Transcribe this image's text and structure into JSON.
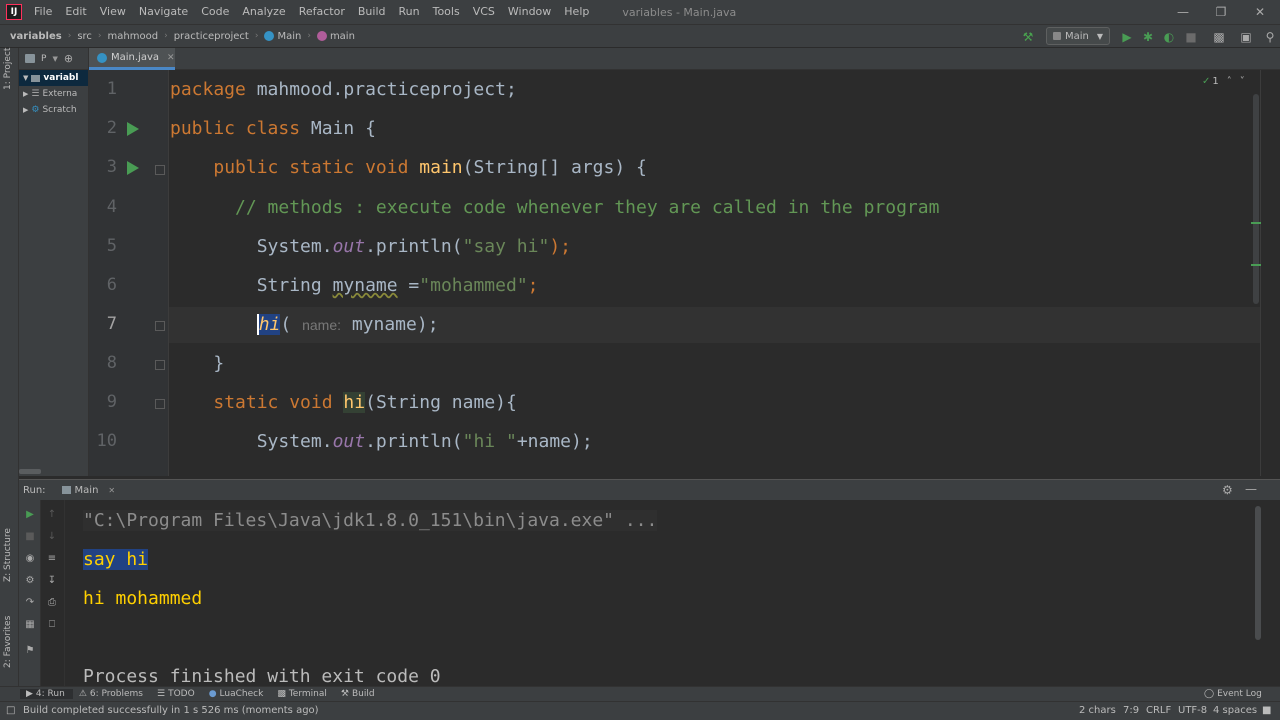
{
  "menubar": {
    "items": [
      "File",
      "Edit",
      "View",
      "Navigate",
      "Code",
      "Analyze",
      "Refactor",
      "Build",
      "Run",
      "Tools",
      "VCS",
      "Window",
      "Help"
    ],
    "window_title": "variables - Main.java"
  },
  "breadcrumbs": [
    "variables",
    "src",
    "mahmood",
    "practiceproject",
    "Main",
    "main"
  ],
  "run_config": "Main",
  "project_panel": {
    "tab": "1: Project",
    "header": "P",
    "items": [
      "variabl",
      "Externa",
      "Scratch"
    ]
  },
  "editor": {
    "tab_label": "Main.java",
    "inspection_count": "1",
    "line_numbers": [
      "1",
      "2",
      "3",
      "4",
      "5",
      "6",
      "7",
      "8",
      "9",
      "10"
    ],
    "line1": {
      "kw": "package",
      "rest": " mahmood.practiceproject;"
    },
    "line2": {
      "kw": "public class",
      "rest": " Main {"
    },
    "line3": {
      "indent": "    ",
      "kw": "public static void",
      "sp": " ",
      "fn": "main",
      "rest": "(String[] args) {"
    },
    "line4": {
      "text": "      // methods : execute code whenever they are called in the program"
    },
    "line5": {
      "a": "        System.",
      "b": "out",
      "c": ".println(",
      "d": "\"say hi\"",
      "e": ");"
    },
    "line6": {
      "a": "        String ",
      "b": "myname",
      "c": " =",
      "d": "\"mohammed\"",
      "e": ";"
    },
    "line7": {
      "indent": "        ",
      "fn": "hi",
      "paren": "( ",
      "hint": "name:",
      "rest": " myname);"
    },
    "line8": {
      "text": "    }"
    },
    "line9": {
      "indent": "    ",
      "kw": "static void",
      "sp": " ",
      "fn": "hi",
      "rest": "(String name){"
    },
    "line10": {
      "a": "        System.",
      "b": "out",
      "c": ".println(",
      "d": "\"hi \"",
      "e": "+name);"
    }
  },
  "run_panel": {
    "label": "Run:",
    "tab": "Main",
    "output": {
      "cmd": "\"C:\\Program Files\\Java\\jdk1.8.0_151\\bin\\java.exe\" ...",
      "line1": "say hi",
      "line2": "hi mohammed",
      "line3": "Process finished with exit code 0"
    }
  },
  "left_strip": {
    "structure": "Z: Structure",
    "favorites": "2: Favorites"
  },
  "bottom_tabs": [
    "4: Run",
    "6: Problems",
    "TODO",
    "LuaCheck",
    "Terminal",
    "Build"
  ],
  "event_log": "Event Log",
  "status": {
    "message": "Build completed successfully in 1 s 526 ms (moments ago)",
    "chars": "2 chars",
    "position": "7:9",
    "line_sep": "CRLF",
    "encoding": "UTF-8",
    "indent": "4 spaces"
  },
  "colors": {
    "accent": "#4a88c7",
    "run_green": "#499c54",
    "selection": "#214283"
  }
}
